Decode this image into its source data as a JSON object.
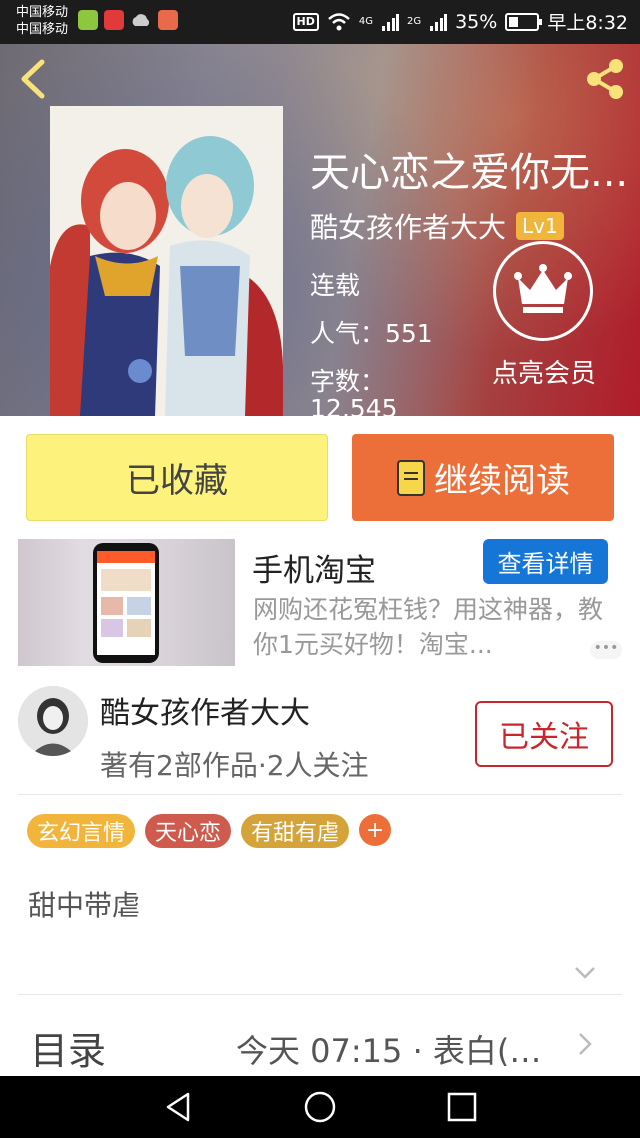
{
  "status_bar": {
    "carrier1": "中国移动",
    "carrier2": "中国移动",
    "hd": "HD",
    "net1": "4G",
    "net2": "2G",
    "battery_text": "35%",
    "battery_level": 0.35,
    "time": "早上8:32"
  },
  "book": {
    "title": "天心恋之爱你无...",
    "author": "酷女孩作者大大",
    "level": "Lv1",
    "status": "连载",
    "popularity": "人气：551",
    "words_label": "字数：",
    "words_value": "12,545",
    "vip_label": "点亮会员"
  },
  "actions": {
    "collected": "已收藏",
    "continue_reading": "继续阅读"
  },
  "ad": {
    "title": "手机淘宝",
    "button": "查看详情",
    "desc": "网购还花冤枉钱？用这神器，教你1元买好物！淘宝..."
  },
  "author_card": {
    "name": "酷女孩作者大大",
    "stats": "著有2部作品·2人关注",
    "follow": "已关注"
  },
  "tags": [
    {
      "label": "玄幻言情",
      "color": "#f1b53c"
    },
    {
      "label": "天心恋",
      "color": "#cf5a4e"
    },
    {
      "label": "有甜有虐",
      "color": "#d4a43b"
    }
  ],
  "tag_add": "+",
  "synopsis": "甜中带虐",
  "catalog": {
    "label": "目录",
    "latest": "今天 07:15 · 表白(雷..."
  },
  "colors": {
    "accent_orange": "#ec6f3a",
    "collected_yellow": "#fcf27c",
    "follow_red": "#c9262b",
    "ad_blue": "#1676d8"
  }
}
